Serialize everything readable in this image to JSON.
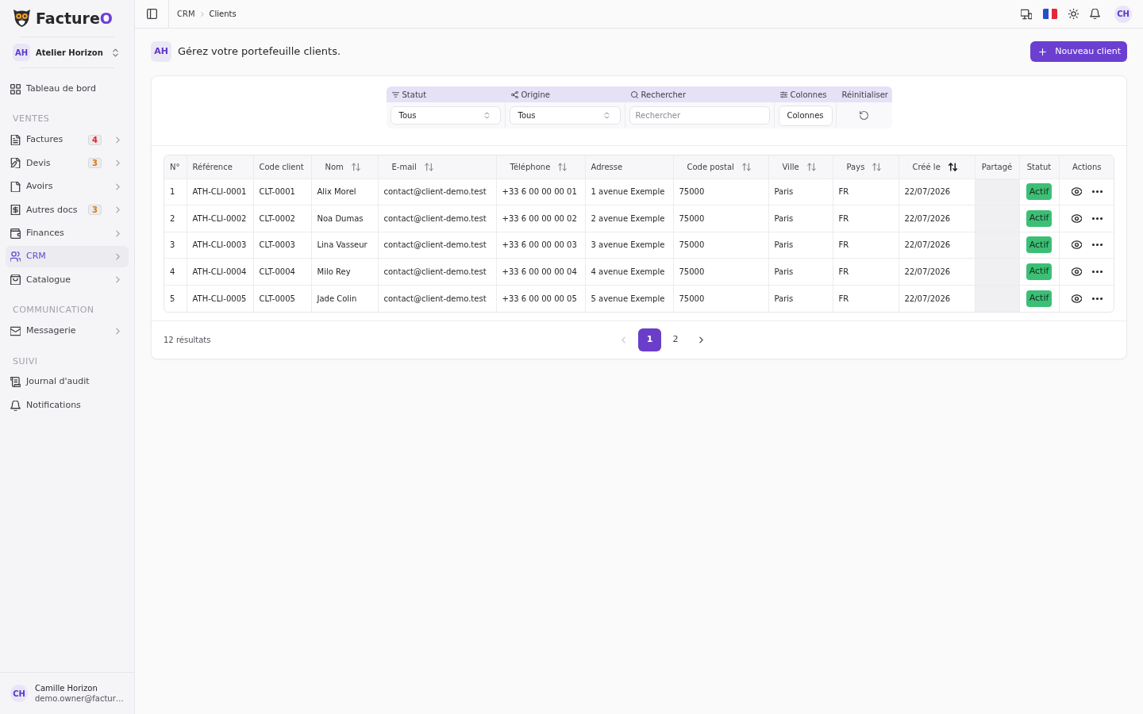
{
  "sidebar": {
    "logo": {
      "text": "Facture",
      "accent": "O"
    },
    "workspace": {
      "initials": "AH",
      "name": "Atelier Horizon"
    },
    "nav": [
      {
        "items": [
          {
            "label": "Tableau de bord",
            "expandable": false,
            "selected": false
          }
        ]
      },
      {
        "title": "VENTES",
        "items": [
          {
            "label": "Factures",
            "badge": {
              "text": "4",
              "color": "#dc2626"
            },
            "expandable": true,
            "selected": false
          },
          {
            "label": "Devis",
            "badge": {
              "text": "3",
              "color": "#d97706"
            },
            "expandable": true,
            "selected": false
          },
          {
            "label": "Avoirs",
            "expandable": true,
            "selected": false
          },
          {
            "label": "Autres docs",
            "badge": {
              "text": "3",
              "color": "#d97706"
            },
            "expandable": true,
            "selected": false
          },
          {
            "label": "Finances",
            "expandable": true,
            "selected": false
          },
          {
            "label": "CRM",
            "expandable": true,
            "selected": true
          },
          {
            "label": "Catalogue",
            "expandable": true,
            "selected": false
          }
        ]
      },
      {
        "title": "COMMUNICATION",
        "items": [
          {
            "label": "Messagerie",
            "expandable": true,
            "selected": false
          }
        ]
      },
      {
        "title": "SUIVI",
        "items": [
          {
            "label": "Journal d'audit",
            "expandable": false,
            "selected": false
          },
          {
            "label": "Notifications",
            "expandable": false,
            "selected": false
          }
        ]
      }
    ],
    "user": {
      "initials": "CH",
      "name": "Camille Horizon",
      "email": "demo.owner@factur…"
    }
  },
  "topbar": {
    "breadcrumb": [
      "CRM",
      "Clients"
    ],
    "avatar": "CH"
  },
  "page": {
    "avatar": "AH",
    "subtitle": "Gérez votre portefeuille clients.",
    "primary_button": "Nouveau client"
  },
  "filters": [
    {
      "kind": "select",
      "label": "Statut",
      "value": "Tous"
    },
    {
      "kind": "select",
      "label": "Origine",
      "value": "Tous"
    },
    {
      "kind": "search",
      "label": "Rechercher",
      "placeholder": "Rechercher"
    },
    {
      "kind": "button",
      "label": "Colonnes",
      "button_label": "Colonnes"
    },
    {
      "kind": "reset",
      "label": "Réinitialiser"
    }
  ],
  "table": {
    "columns": [
      {
        "label": "N°",
        "kind": "text",
        "sortable": false
      },
      {
        "label": "Référence",
        "kind": "text",
        "sortable": false
      },
      {
        "label": "Code client",
        "kind": "text",
        "sortable": false
      },
      {
        "label": "Nom",
        "kind": "text",
        "sortable": true,
        "sorted": false
      },
      {
        "label": "E-mail",
        "kind": "text",
        "sortable": true,
        "sorted": false
      },
      {
        "label": "Téléphone",
        "kind": "text",
        "sortable": true,
        "sorted": false
      },
      {
        "label": "Adresse",
        "kind": "text",
        "sortable": false
      },
      {
        "label": "Code postal",
        "kind": "text",
        "sortable": true,
        "sorted": false
      },
      {
        "label": "Ville",
        "kind": "text",
        "sortable": true,
        "sorted": false
      },
      {
        "label": "Pays",
        "kind": "text",
        "sortable": true,
        "sorted": false
      },
      {
        "label": "Créé le",
        "kind": "text",
        "sortable": true,
        "sorted": true
      },
      {
        "label": "Partagé",
        "kind": "shared",
        "sortable": false
      },
      {
        "label": "Statut",
        "kind": "status",
        "sortable": false
      },
      {
        "label": "Actions",
        "kind": "actions",
        "sortable": false
      }
    ],
    "rows": [
      {
        "cells": [
          "1",
          "ATH-CLI-0001",
          "CLT-0001",
          "Alix Morel",
          "contact@client-demo.test",
          "+33 6 00 00 00 01",
          "1 avenue Exemple",
          "75000",
          "Paris",
          "FR",
          "22/07/2026"
        ],
        "status": {
          "label": "Actif",
          "kind": "active"
        }
      },
      {
        "cells": [
          "2",
          "ATH-CLI-0002",
          "CLT-0002",
          "Noa Dumas",
          "contact@client-demo.test",
          "+33 6 00 00 00 02",
          "2 avenue Exemple",
          "75000",
          "Paris",
          "FR",
          "22/07/2026"
        ],
        "status": {
          "label": "Actif",
          "kind": "active"
        }
      },
      {
        "cells": [
          "3",
          "ATH-CLI-0003",
          "CLT-0003",
          "Lina Vasseur",
          "contact@client-demo.test",
          "+33 6 00 00 00 03",
          "3 avenue Exemple",
          "75000",
          "Paris",
          "FR",
          "22/07/2026"
        ],
        "status": {
          "label": "Actif",
          "kind": "active"
        }
      },
      {
        "cells": [
          "4",
          "ATH-CLI-0004",
          "CLT-0004",
          "Milo Rey",
          "contact@client-demo.test",
          "+33 6 00 00 00 04",
          "4 avenue Exemple",
          "75000",
          "Paris",
          "FR",
          "22/07/2026"
        ],
        "status": {
          "label": "Actif",
          "kind": "active"
        }
      },
      {
        "cells": [
          "5",
          "ATH-CLI-0005",
          "CLT-0005",
          "Jade Colin",
          "contact@client-demo.test",
          "+33 6 00 00 00 05",
          "5 avenue Exemple",
          "75000",
          "Paris",
          "FR",
          "22/07/2026"
        ],
        "status": {
          "label": "Actif",
          "kind": "active"
        }
      }
    ]
  },
  "pagination": {
    "summary": "12 résultats",
    "previous": {
      "disabled": true
    },
    "next": {
      "disabled": false
    },
    "pages": [
      {
        "label": "1",
        "selected": true
      },
      {
        "label": "2",
        "selected": false
      }
    ]
  }
}
